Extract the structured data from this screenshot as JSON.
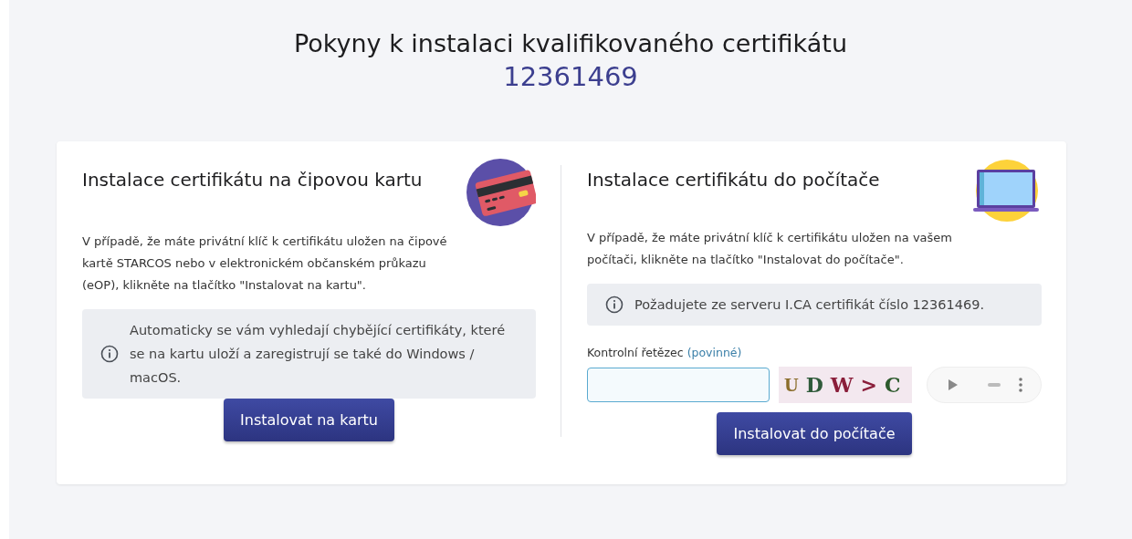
{
  "page_title": "Pokyny k instalaci kvalifikovaného certifikátu",
  "certificate_number": "12361469",
  "panels": [
    {
      "kind": "card",
      "title": "Instalace certifikátu na čipovou kartu",
      "description": "V případě, že máte privátní klíč k certifikátu uložen na čipové kartě STARCOS nebo v elektronickém občanském průkazu (eOP), klikněte na tlačítko \"Instalovat na kartu\".",
      "info": "Automaticky se vám vyhledají chybějící certifikáty, které se na kartu uloží a zaregistrují se také do Windows / macOS.",
      "button": "Instalovat na kartu"
    },
    {
      "kind": "computer",
      "title": "Instalace certifikátu do počítače",
      "description": "V případě, že máte privátní klíč k certifikátu uložen na vašem počítači, klikněte na tlačítko \"Instalovat do počítače\".",
      "info": "Požadujete ze serveru I.CA certifikát číslo 12361469.",
      "captcha": {
        "label": "Kontrolní řetězec",
        "required": "(povinné)",
        "chars": [
          "U",
          "D",
          "W",
          ">",
          "C"
        ]
      },
      "button": "Instalovat do počítače"
    }
  ]
}
